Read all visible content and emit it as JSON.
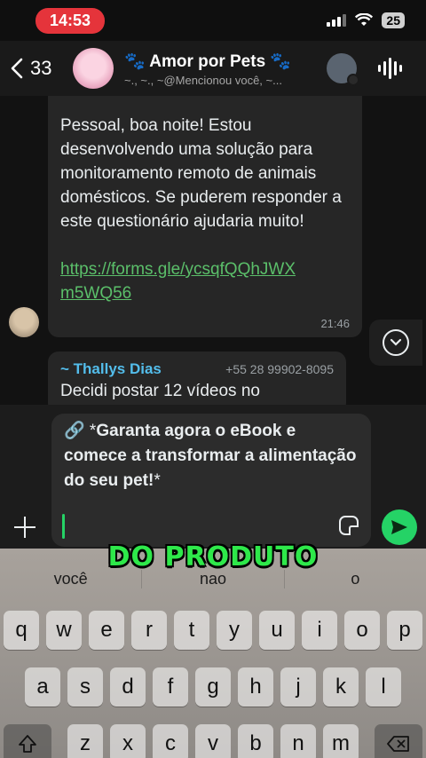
{
  "status_bar": {
    "time": "14:53",
    "battery": "25"
  },
  "header": {
    "back_count": "33",
    "title": "🐾 Amor por Pets 🐾",
    "subtitle": "~., ~., ~@Mencionou você, ~..."
  },
  "messages": [
    {
      "text": "Pessoal, boa noite! Estou desenvolvendo uma solução para monitoramento remoto de animais domésticos. Se puderem responder a este questionário ajudaria muito!",
      "link": "https://forms.gle/ycsqfQQhJWXm5WQ56",
      "time": "21:46"
    },
    {
      "sender": "~ Thallys Dias",
      "phone": "+55 28 99902-8095",
      "text": "Decidi postar 12 vídeos no"
    }
  ],
  "compose": {
    "quote_prefix": "🔗 *",
    "quote_bold": "Garanta agora o eBook e comece a transformar a alimentação do seu pet!",
    "quote_suffix": "*"
  },
  "overlay_caption": "DO PRODUTO",
  "keyboard": {
    "suggestions": [
      "você",
      "nao",
      "o"
    ],
    "row1": [
      "q",
      "w",
      "e",
      "r",
      "t",
      "y",
      "u",
      "i",
      "o",
      "p"
    ],
    "row2": [
      "a",
      "s",
      "d",
      "f",
      "g",
      "h",
      "j",
      "k",
      "l"
    ],
    "row3": [
      "z",
      "x",
      "c",
      "v",
      "b",
      "n",
      "m"
    ]
  }
}
